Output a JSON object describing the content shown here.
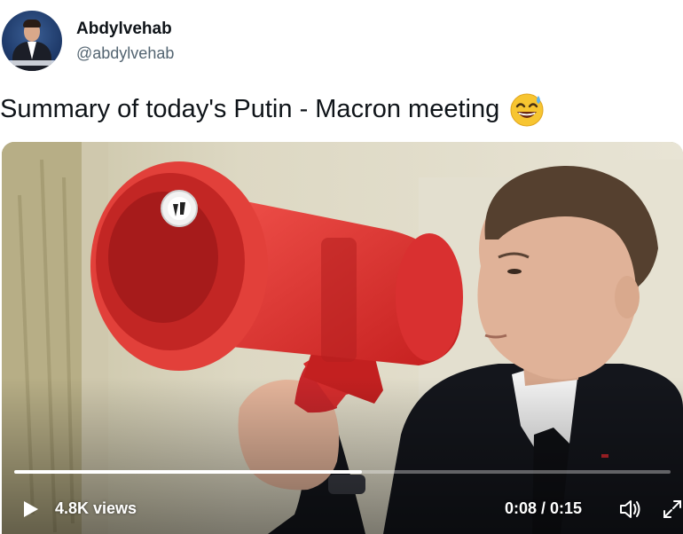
{
  "author": {
    "display_name": "Abdylvehab",
    "handle": "@abdylvehab",
    "avatar": "profile-photo"
  },
  "tweet": {
    "text": "Summary of today's Putin - Macron meeting",
    "emoji": "grinning-face-with-sweat"
  },
  "video": {
    "views": "4.8K views",
    "time": "0:08 / 0:15",
    "progress": 0.53,
    "icons": {
      "play": "play-icon",
      "volume": "volume-icon",
      "fullscreen": "fullscreen-icon"
    }
  }
}
